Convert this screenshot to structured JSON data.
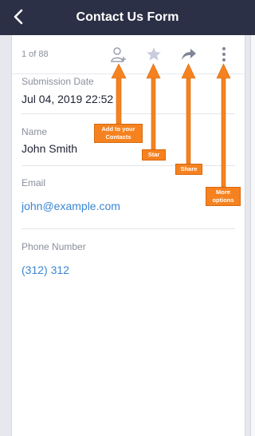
{
  "header": {
    "title": "Contact Us Form"
  },
  "record": {
    "counter": "1 of 88"
  },
  "fields": {
    "submission_date": {
      "label": "Submission Date",
      "value": "Jul 04, 2019 22:52"
    },
    "name": {
      "label": "Name",
      "value": "John Smith"
    },
    "email": {
      "label": "Email",
      "value": "john@example.com"
    },
    "phone": {
      "label": "Phone Number",
      "value": "(312) 312"
    }
  },
  "annotations": {
    "add_contact": "Add to your Contacts",
    "star": "Star",
    "share": "Share",
    "more": "More options"
  },
  "colors": {
    "topbar": "#2b3046",
    "accent": "#f6821f",
    "link": "#3a86d1"
  },
  "icons": {
    "back": "chevron-left-icon",
    "add_contact": "add-user-icon",
    "star": "star-icon",
    "share": "share-icon",
    "more": "more-vertical-icon"
  }
}
